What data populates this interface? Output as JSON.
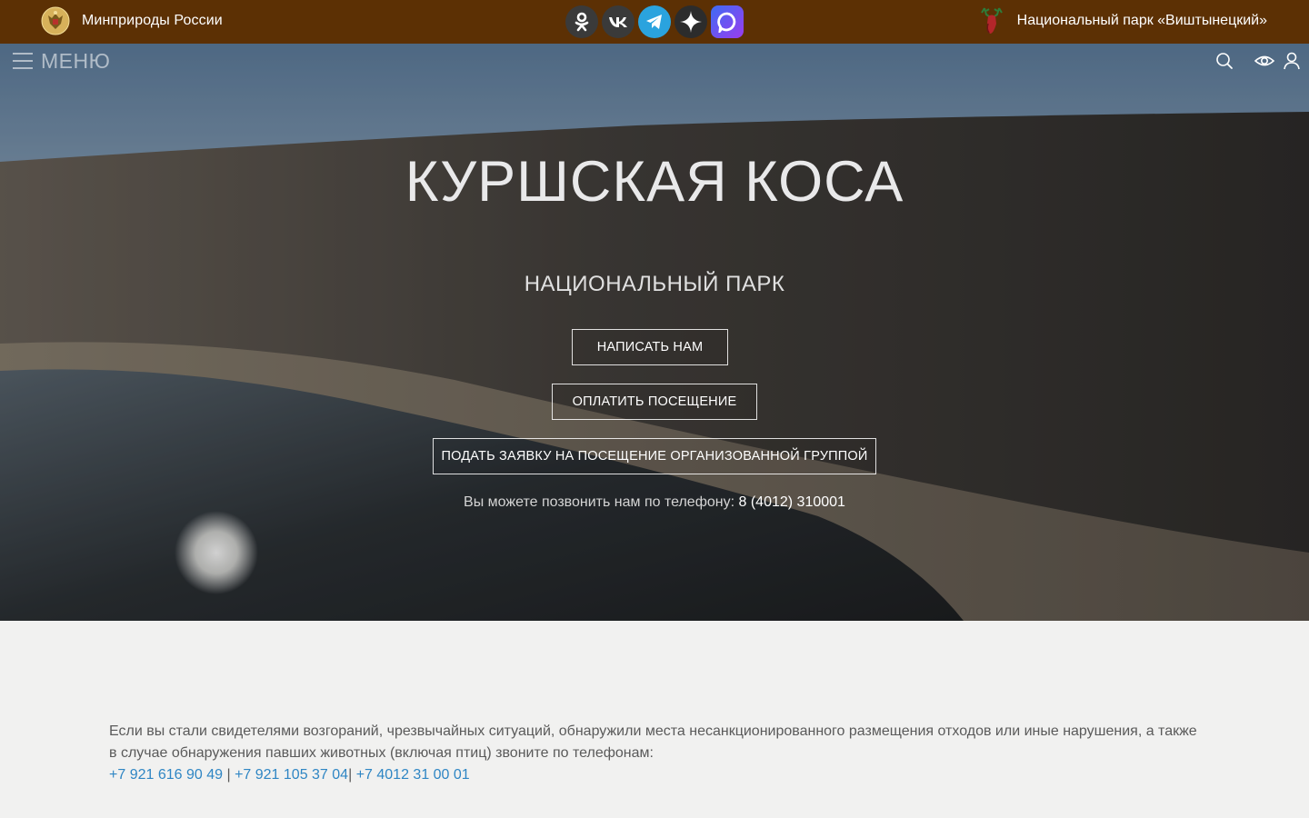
{
  "header": {
    "ministry_label": "Минприроды России",
    "park_label": "Национальный парк «Виштынецкий»",
    "socials": [
      {
        "name": "odnoklassniki",
        "icon": "ok-icon"
      },
      {
        "name": "vkontakte",
        "icon": "vk-icon"
      },
      {
        "name": "telegram",
        "icon": "telegram-icon"
      },
      {
        "name": "dzen",
        "icon": "dzen-star-icon"
      },
      {
        "name": "max",
        "icon": "max-messenger-icon"
      }
    ],
    "colors": {
      "background": "#5c3004"
    }
  },
  "hero": {
    "menu_label": "МЕНЮ",
    "title": "КУРШСКАЯ КОСА",
    "subtitle": "НАЦИОНАЛЬНЫЙ ПАРК",
    "buttons": {
      "write": "НАПИСАТЬ НАМ",
      "pay": "ОПЛАТИТЬ ПОСЕЩЕНИЕ",
      "group": "ПОДАТЬ ЗАЯВКУ НА ПОСЕЩЕНИЕ ОРГАНИЗОВАННОЙ ГРУППОЙ"
    },
    "phone_text": "Вы можете позвонить нам по телефону:",
    "phone_number": "8 (4012) 310001",
    "tools": [
      "search-icon",
      "visually-impaired-eye-icon",
      "user-icon"
    ]
  },
  "notice": {
    "text": "Если вы стали свидетелями возгораний, чрезвычайных ситуаций, обнаружили места несанкционированного размещения отходов или иные нарушения, а также в случае обнаружения павших животных (включая птиц) звоните по телефонам:",
    "phones": [
      "+7 921 616 90 49",
      "+7 921 105 37 04",
      "+7 4012 31 00 01"
    ],
    "separators": [
      " | ",
      "| "
    ],
    "link_color": "#2f86c4"
  }
}
